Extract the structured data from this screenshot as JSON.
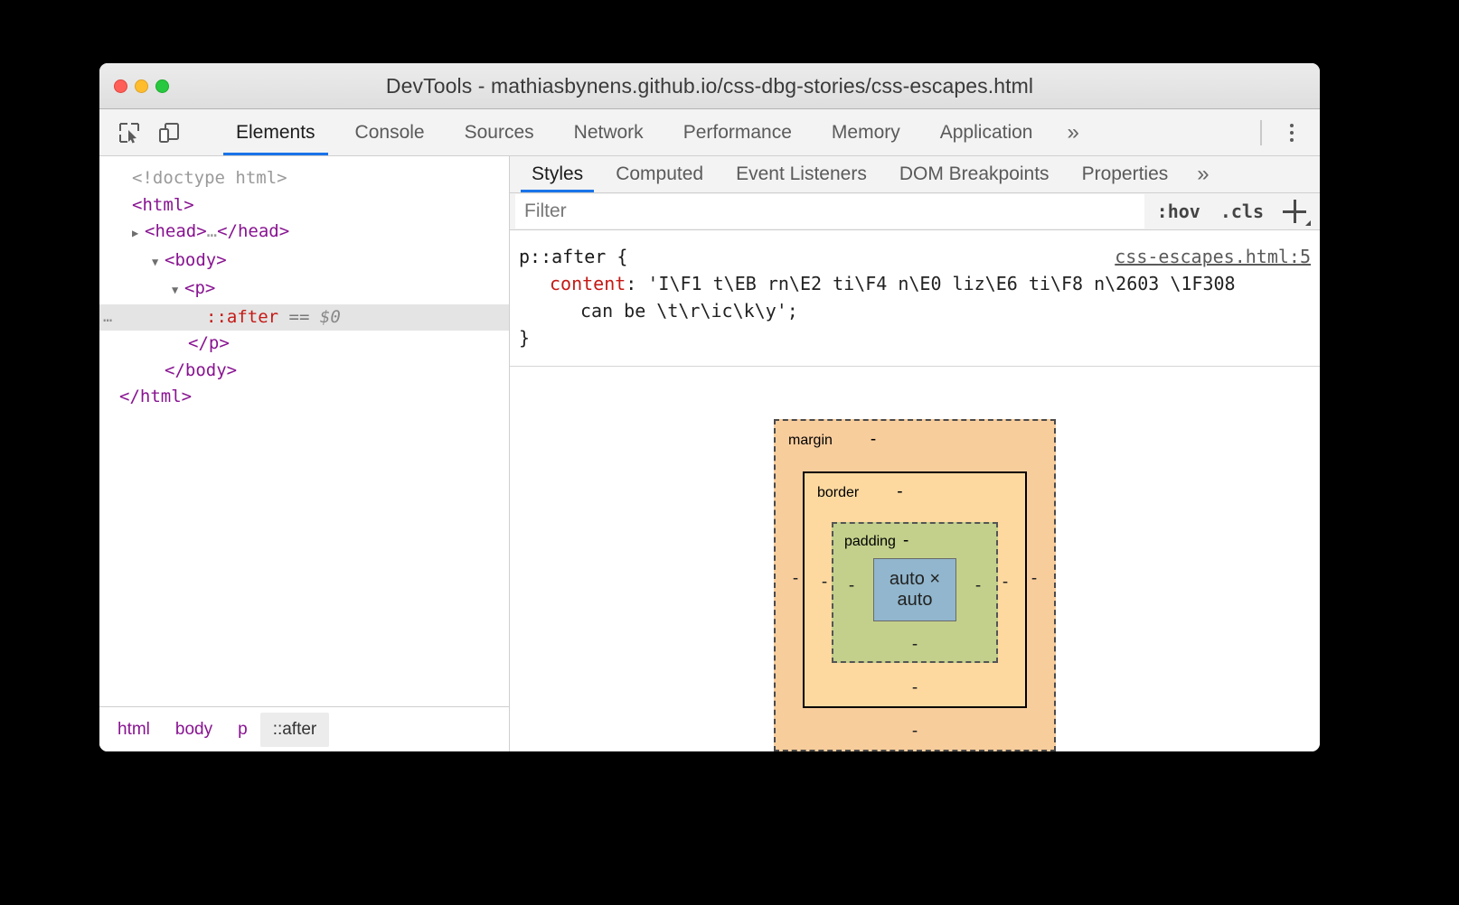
{
  "window": {
    "title": "DevTools - mathiasbynens.github.io/css-dbg-stories/css-escapes.html",
    "traffic_lights": [
      "close-button",
      "minimize-button",
      "maximize-button"
    ]
  },
  "toolbar": {
    "inspect_icon": "inspect-element-icon",
    "device_icon": "device-toolbar-icon",
    "tabs": [
      {
        "label": "Elements",
        "active": true
      },
      {
        "label": "Console",
        "active": false
      },
      {
        "label": "Sources",
        "active": false
      },
      {
        "label": "Network",
        "active": false
      },
      {
        "label": "Performance",
        "active": false
      },
      {
        "label": "Memory",
        "active": false
      },
      {
        "label": "Application",
        "active": false
      }
    ],
    "more_tabs": "»",
    "menu_icon": "kebab-menu-icon"
  },
  "dom_tree": {
    "nodes": [
      {
        "indent": 0,
        "twisty": "",
        "text": "<!doctype html>",
        "kind": "doctype"
      },
      {
        "indent": 0,
        "twisty": "",
        "open": "<html>",
        "kind": "tag"
      },
      {
        "indent": 1,
        "twisty": "▶",
        "open": "<head>",
        "ellipsis": "…",
        "close": "</head>",
        "kind": "tag"
      },
      {
        "indent": 1,
        "twisty": "▼",
        "open": "<body>",
        "kind": "tag"
      },
      {
        "indent": 2,
        "twisty": "▼",
        "open": "<p>",
        "kind": "tag"
      },
      {
        "indent": 3,
        "twisty": "",
        "pseudo": "::after",
        "eq": "==",
        "dollar": "$0",
        "selected": true,
        "overflow": "…"
      },
      {
        "indent": 2,
        "twisty": "",
        "open": "</p>",
        "kind": "tag"
      },
      {
        "indent": 1,
        "twisty": "",
        "open": "</body>",
        "kind": "tag"
      },
      {
        "indent": 0,
        "twisty": "",
        "open": "</html>",
        "kind": "tag"
      }
    ]
  },
  "breadcrumb": {
    "items": [
      {
        "label": "html",
        "active": false
      },
      {
        "label": "body",
        "active": false
      },
      {
        "label": "p",
        "active": false
      },
      {
        "label": "::after",
        "active": true
      }
    ]
  },
  "styles_pane": {
    "tabs": [
      {
        "label": "Styles",
        "active": true
      },
      {
        "label": "Computed",
        "active": false
      },
      {
        "label": "Event Listeners",
        "active": false
      },
      {
        "label": "DOM Breakpoints",
        "active": false
      },
      {
        "label": "Properties",
        "active": false
      }
    ],
    "more_tabs": "»",
    "filter": {
      "value": "",
      "placeholder": "Filter"
    },
    "hov_button": ":hov",
    "cls_button": ".cls",
    "new_rule_icon": "plus-icon",
    "rule": {
      "selector": "p::after {",
      "source_link": "css-escapes.html:5",
      "property": "content",
      "colon": ":",
      "value_line1": " 'I\\F1 t\\EB rn\\E2 ti\\F4 n\\E0 liz\\E6 ti\\F8 n\\2603 \\1F308",
      "value_line2": "can be \\t\\r\\ic\\k\\y';",
      "close_brace": "}"
    }
  },
  "box_model": {
    "margin_label": "margin",
    "margin_values": {
      "top": "-",
      "right": "-",
      "bottom": "-",
      "left": "-"
    },
    "border_label": "border",
    "border_values": {
      "top": "-",
      "right": "-",
      "bottom": "-",
      "left": "-"
    },
    "padding_label": "padding",
    "padding_values": {
      "top": "-",
      "right": "-",
      "bottom": "-",
      "left": "-"
    },
    "content_size": "auto × auto",
    "colors": {
      "margin": "#f8cd9c",
      "border": "#fdd9a0",
      "padding": "#c3d08b",
      "content": "#91b6cd"
    }
  },
  "accent_color": "#1a73e8"
}
